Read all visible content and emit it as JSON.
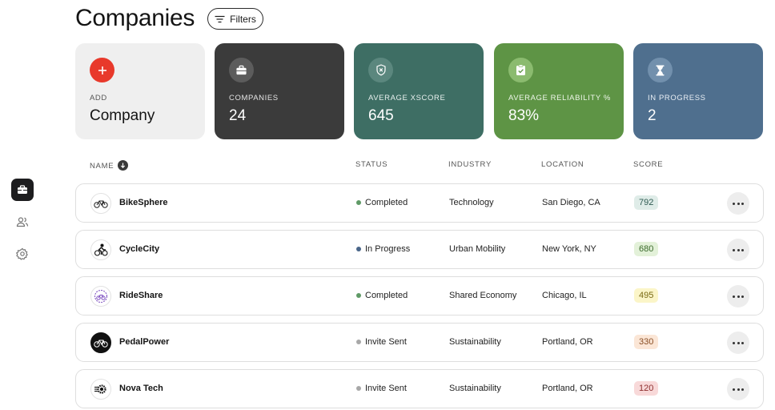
{
  "header": {
    "title": "Companies",
    "filters_label": "Filters"
  },
  "sidebar": {
    "items": [
      {
        "icon": "briefcase-icon",
        "active": true
      },
      {
        "icon": "users-icon",
        "active": false
      },
      {
        "icon": "gear-icon",
        "active": false
      }
    ]
  },
  "cards": {
    "add": {
      "label": "ADD",
      "value": "Company",
      "icon": "plus-icon",
      "bg": "#efefef",
      "accent": "#e8392b"
    },
    "companies": {
      "label": "COMPANIES",
      "value": "24",
      "icon": "briefcase-icon",
      "bg": "#3b3b3b"
    },
    "xscore": {
      "label": "AVERAGE XSCORE",
      "value": "645",
      "icon": "shield-x-icon",
      "bg": "#3e6e64"
    },
    "reliability": {
      "label": "AVERAGE RELIABILITY %",
      "value": "83%",
      "icon": "clipboard-check-icon",
      "bg": "#5e9445"
    },
    "progress": {
      "label": "IN PROGRESS",
      "value": "2",
      "icon": "hourglass-icon",
      "bg": "#4f6f8e"
    }
  },
  "table": {
    "columns": {
      "name": "NAME",
      "status": "STATUS",
      "industry": "INDUSTRY",
      "location": "LOCATION",
      "score": "SCORE"
    },
    "rows": [
      {
        "name": "BikeSphere",
        "logo": "bicycle-icon",
        "status": "Completed",
        "status_color": "#5f9a66",
        "industry": "Technology",
        "location": "San Diego, CA",
        "score": "792",
        "score_bg": "#dfece8",
        "score_color": "#2f5b52"
      },
      {
        "name": "CycleCity",
        "logo": "cyclist-icon",
        "status": "In Progress",
        "status_color": "#4a6689",
        "industry": "Urban Mobility",
        "location": "New York, NY",
        "score": "680",
        "score_bg": "#e3f1d9",
        "score_color": "#3a6a2b"
      },
      {
        "name": "RideShare",
        "logo": "ride-share-icon",
        "status": "Completed",
        "status_color": "#5f9a66",
        "industry": "Shared Economy",
        "location": "Chicago, IL",
        "score": "495",
        "score_bg": "#fbf5c8",
        "score_color": "#7a6a14"
      },
      {
        "name": "PedalPower",
        "logo": "bicycle-dark-icon",
        "status": "Invite Sent",
        "status_color": "#a8a8a8",
        "industry": "Sustainability",
        "location": "Portland, OR",
        "score": "330",
        "score_bg": "#fbe6d6",
        "score_color": "#8a4e24"
      },
      {
        "name": "Nova Tech",
        "logo": "gear-wheel-icon",
        "status": "Invite Sent",
        "status_color": "#a8a8a8",
        "industry": "Sustainability",
        "location": "Portland, OR",
        "score": "120",
        "score_bg": "#f8d9d9",
        "score_color": "#8e2f2f"
      }
    ]
  }
}
